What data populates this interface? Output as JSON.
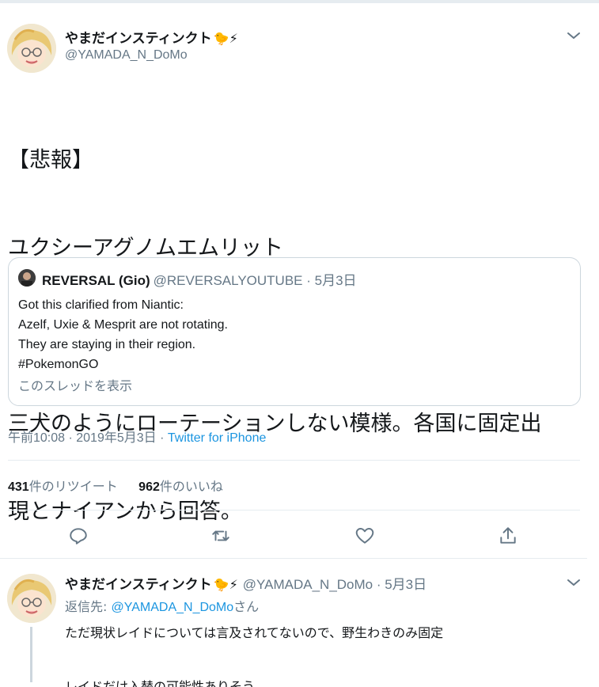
{
  "tweet": {
    "display_name": "やまだインスティンクト",
    "name_emoji": "🐤⚡",
    "handle": "@YAMADA_N_DoMo",
    "text_lines": [
      "【悲報】",
      "ユクシーアグノムエムリット",
      "",
      "三犬のようにローテーションしない模様。各国に固定出",
      "現とナイアンから回答。"
    ],
    "quote": {
      "name": "REVERSAL (Gio)",
      "handle": "@REVERSALYOUTUBE · 5月3日",
      "lines": [
        "Got this clarified from Niantic:",
        "Azelf, Uxie & Mesprit are not rotating.",
        "They are staying in their region.",
        "#PokemonGO"
      ],
      "show_thread": "このスレッドを表示"
    },
    "timestamp": "午前10:08 · 2019年5月3日 · ",
    "source": "Twitter for iPhone",
    "retweets_count": "431",
    "retweets_label": "件のリツイート",
    "likes_count": "962",
    "likes_label": "件のいいね"
  },
  "icons": {
    "reply": "reply-icon",
    "retweet": "retweet-icon",
    "like": "heart-icon",
    "share": "share-icon",
    "more": "chevron-down-icon"
  },
  "reply": {
    "display_name": "やまだインスティンクト",
    "name_emoji": "🐤⚡",
    "handle": "@YAMADA_N_DoMo · 5月3日",
    "replying_prefix": "返信先: ",
    "replying_to": "@YAMADA_N_DoMo",
    "replying_suffix": "さん",
    "text_lines": [
      "ただ現状レイドについては言及されてないので、野生わきのみ固定",
      "",
      "レイドだけ入替の可能性ありそう"
    ]
  },
  "colors": {
    "link": "#1b95e0",
    "secondary_text": "#657786",
    "border": "#e6ecf0"
  }
}
